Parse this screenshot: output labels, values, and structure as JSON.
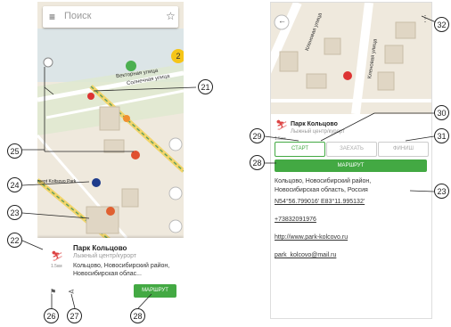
{
  "left_screen": {
    "search": {
      "menu_icon": "hamburger-menu-icon",
      "placeholder": "Поиск",
      "star_icon": "star-icon"
    },
    "badge": "2",
    "map_labels": [
      "Векторная улица",
      "Солнечная улица"
    ],
    "poi_label": "mept Koltsovo Park",
    "card": {
      "title": "Парк Кольцово",
      "category": "Лыжный центр/курорт",
      "distance": "1.5км",
      "address": "Кольцово, Новосибирский район, Новосибирская облас...",
      "route_button": "МАРШРУТ"
    }
  },
  "right_screen": {
    "map_labels": [
      "Кленовая улица",
      "Кленовая улица"
    ],
    "title": "Парк Кольцово",
    "category": "Лыжный центр/курорт",
    "distance": "1.5км",
    "tabs": {
      "start": "СТАРТ",
      "enter": "ЗАЕХАТЬ",
      "finish": "ФИНИШ"
    },
    "route_button": "МАРШРУТ",
    "address": "Кольцово, Новосибирский район, Новосибирская область, Россия",
    "coordinates": "N54°56.799016' E83°11.995132'",
    "phone": "+73832091976",
    "website": "http://www.park-kolcovo.ru",
    "email": "park_kolcovo@mail.ru"
  },
  "callouts": [
    "21",
    "25",
    "24",
    "23",
    "22",
    "26",
    "27",
    "28",
    "32",
    "30",
    "29",
    "31",
    "28",
    "23"
  ],
  "colors": {
    "accent_green": "#43a943",
    "road_yellow": "#f2d56b",
    "map_bg": "#efe9dd"
  }
}
